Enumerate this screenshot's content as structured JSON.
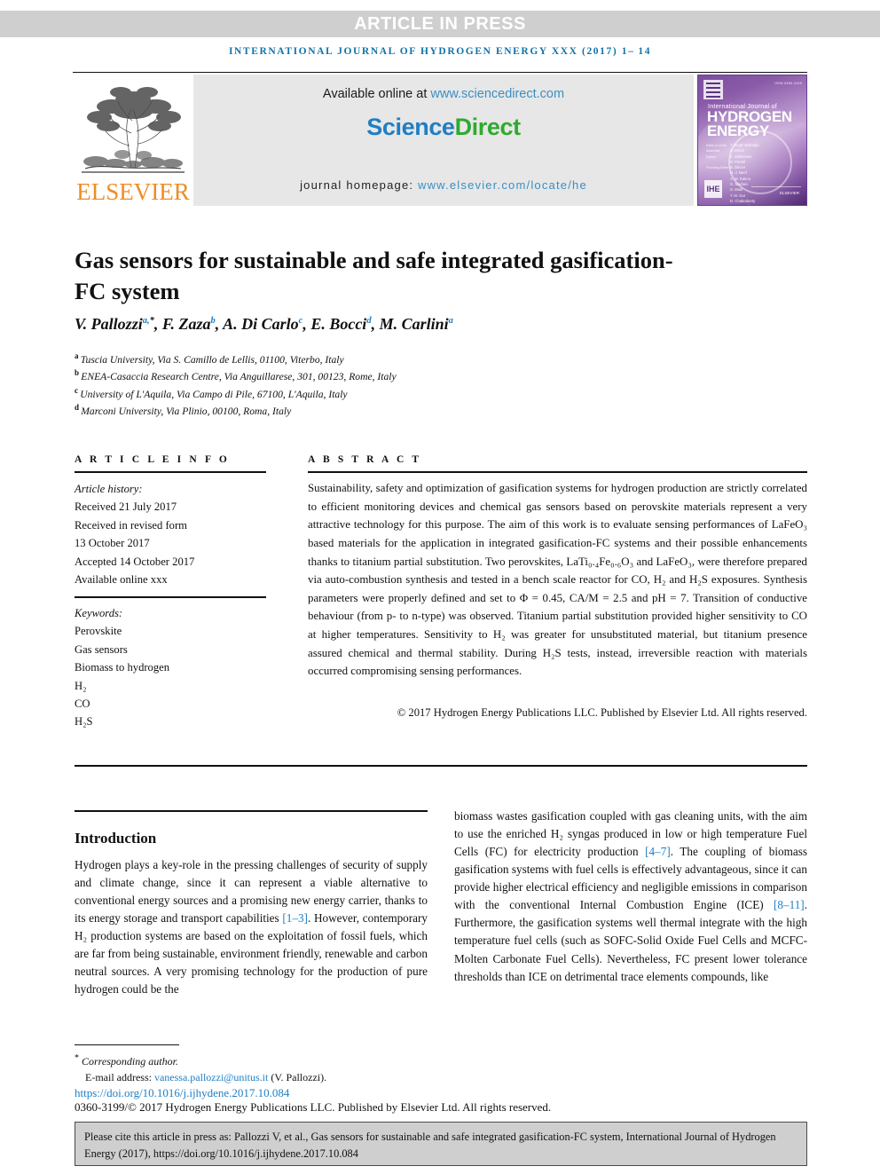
{
  "banner": {
    "press_label": "ARTICLE IN PRESS",
    "running_head": "INTERNATIONAL JOURNAL OF HYDROGEN ENERGY XXX (2017) 1– 14"
  },
  "header": {
    "available_prefix": "Available online at ",
    "available_link": "www.sciencedirect.com",
    "sciencedirect_science": "Science",
    "sciencedirect_direct": "Direct",
    "homepage_prefix": "journal homepage: ",
    "homepage_link": "www.elsevier.com/locate/he",
    "publisher_wordmark": "ELSEVIER",
    "cover": {
      "issn": "ISSN 0360-3199",
      "kicker": "International Journal of",
      "line1": "HYDROGEN",
      "line2": "ENERGY",
      "labels": "Editor-in-Chief\nAssociate Editors\n\nFounding Editor",
      "names": "T. Nejat Veziroglu\nA. Ersoz\nE. Zalnieriute\nR. Ferrell\nB. Dincer\nH.-J. Neef\nA. M. Kanno\nG. Marban\nS. Maiti\nT. M. Gur\nD. Chakraborty\nP. M. Ferrell\nA. Yurum",
      "society_mark": "IHE",
      "publisher_mark": "ELSEVIER"
    },
    "colors": {
      "press_band": "#cfcfcf",
      "running_head": "#1073a8",
      "link_blue": "#3a8fc4",
      "science_blue": "#1f7ec4",
      "direct_green": "#2faa2f",
      "elsevier_orange": "#f08c25",
      "cover_purple": "#7a4f9e"
    }
  },
  "article": {
    "title": "Gas sensors for sustainable and safe integrated gasification-FC system",
    "authors": [
      {
        "name": "V. Pallozzi",
        "sup": "a,",
        "star": "*"
      },
      {
        "name": "F. Zaza",
        "sup": "b"
      },
      {
        "name": "A. Di Carlo",
        "sup": "c"
      },
      {
        "name": "E. Bocci",
        "sup": "d"
      },
      {
        "name": "M. Carlini",
        "sup": "a"
      }
    ],
    "affiliations": [
      {
        "marker": "a",
        "text": "Tuscia University, Via S. Camillo de Lellis, 01100, Viterbo, Italy"
      },
      {
        "marker": "b",
        "text": "ENEA-Casaccia Research Centre, Via Anguillarese, 301, 00123, Rome, Italy"
      },
      {
        "marker": "c",
        "text": "University of L'Aquila, Via Campo di Pile, 67100, L'Aquila, Italy"
      },
      {
        "marker": "d",
        "text": "Marconi University, Via Plinio, 00100, Roma, Italy"
      }
    ]
  },
  "article_info": {
    "heading": "A R T I C L E   I N F O",
    "history_label": "Article history:",
    "history": [
      "Received 21 July 2017",
      "Received in revised form",
      "13 October 2017",
      "Accepted 14 October 2017",
      "Available online xxx"
    ],
    "keywords_label": "Keywords:",
    "keywords": [
      "Perovskite",
      "Gas sensors",
      "Biomass to hydrogen",
      "H₂",
      "CO",
      "H₂S"
    ]
  },
  "abstract": {
    "heading": "A B S T R A C T",
    "text": "Sustainability, safety and optimization of gasification systems for hydrogen production are strictly correlated to efficient monitoring devices and chemical gas sensors based on perovskite materials represent a very attractive technology for this purpose. The aim of this work is to evaluate sensing performances of LaFeO₃ based materials for the application in integrated gasification-FC systems and their possible enhancements thanks to titanium partial substitution. Two perovskites, LaTi₀.₄Fe₀.₆O₃ and LaFeO₃, were therefore prepared via auto-combustion synthesis and tested in a bench scale reactor for CO, H₂ and H₂S exposures. Synthesis parameters were properly defined and set to Φ = 0.45, CA/M = 2.5 and pH = 7. Transition of conductive behaviour (from p- to n-type) was observed. Titanium partial substitution provided higher sensitivity to CO at higher temperatures. Sensitivity to H₂ was greater for unsubstituted material, but titanium presence assured chemical and thermal stability. During H₂S tests, instead, irreversible reaction with materials occurred compromising sensing performances.",
    "copyright": "© 2017 Hydrogen Energy Publications LLC. Published by Elsevier Ltd. All rights reserved."
  },
  "body": {
    "section_title": "Introduction",
    "left_paragraph_part1": "Hydrogen plays a key-role in the pressing challenges of security of supply and climate change, since it can represent a viable alternative to conventional energy sources and a promising new energy carrier, thanks to its energy storage and transport capabilities ",
    "left_ref1": "[1–3]",
    "left_paragraph_part2": ". However, contemporary H₂ production systems are based on the exploitation of fossil fuels, which are far from being sustainable, environment friendly, renewable and carbon neutral sources. A very promising technology for the production of pure hydrogen could be the",
    "right_part1": "biomass wastes gasification coupled with gas cleaning units, with the aim to use the enriched H₂ syngas produced in low or high temperature Fuel Cells (FC) for electricity production ",
    "right_ref1": "[4–7]",
    "right_part2": ". The coupling of biomass gasification systems with fuel cells is effectively advantageous, since it can provide higher electrical efficiency and negligible emissions in comparison with the conventional Internal Combustion Engine (ICE) ",
    "right_ref2": "[8–11]",
    "right_part3": ". Furthermore, the gasification systems well thermal integrate with the high temperature fuel cells (such as SOFC-Solid Oxide Fuel Cells and MCFC-Molten Carbonate Fuel Cells). Nevertheless, FC present lower tolerance thresholds than ICE on detrimental trace elements compounds, like"
  },
  "footer": {
    "corresponding_marker": "*",
    "corresponding_label": " Corresponding author.",
    "email_label": "E-mail address: ",
    "email": "vanessa.pallozzi@unitus.it",
    "email_suffix": " (V. Pallozzi).",
    "doi": "https://doi.org/10.1016/j.ijhydene.2017.10.084",
    "issn_copyright": "0360-3199/© 2017 Hydrogen Energy Publications LLC. Published by Elsevier Ltd. All rights reserved.",
    "cite_text": "Please cite this article in press as: Pallozzi V, et al., Gas sensors for sustainable and safe integrated gasification-FC system, International Journal of Hydrogen Energy (2017), https://doi.org/10.1016/j.ijhydene.2017.10.084"
  }
}
